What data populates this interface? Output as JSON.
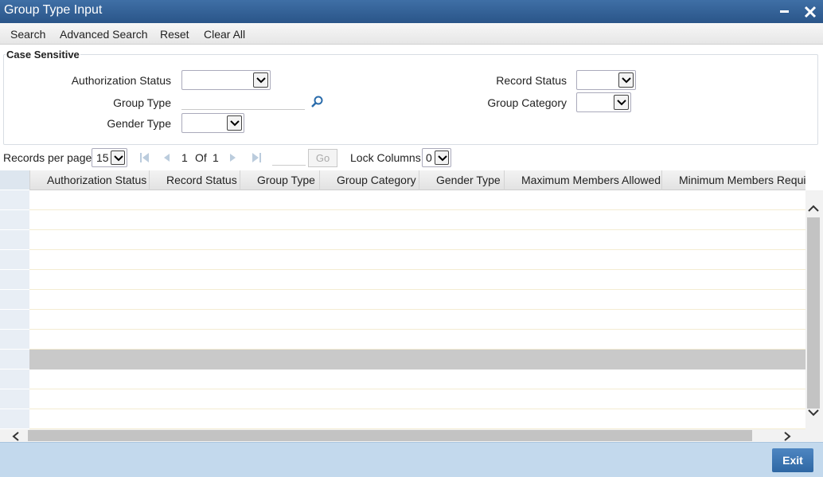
{
  "window": {
    "title": "Group Type Input",
    "minimize_glyph": "▬",
    "close_glyph": "✕"
  },
  "toolbar": {
    "search": "Search",
    "advanced_search": "Advanced Search",
    "reset": "Reset",
    "clear_all": "Clear All"
  },
  "criteria": {
    "legend": "Case Sensitive",
    "authorization_status_label": "Authorization Status",
    "group_type_label": "Group Type",
    "gender_type_label": "Gender Type",
    "record_status_label": "Record Status",
    "group_category_label": "Group Category"
  },
  "pager": {
    "records_per_page_label": "Records per page",
    "records_per_page_value": "15",
    "current_page": "1",
    "of_label": "Of",
    "total_pages": "1",
    "go_label": "Go",
    "lock_columns_label": "Lock Columns",
    "lock_columns_value": "0"
  },
  "grid": {
    "columns": [
      "Authorization Status",
      "Record Status",
      "Group Type",
      "Group Category",
      "Gender Type",
      "Maximum Members Allowed",
      "Minimum Members Requi"
    ],
    "row_count": 12,
    "selected_row": 8
  },
  "footer": {
    "exit_label": "Exit"
  },
  "colors": {
    "titlebar": "#2a5589",
    "footer": "#c3d9ed",
    "exit_button": "#2e67a4"
  }
}
